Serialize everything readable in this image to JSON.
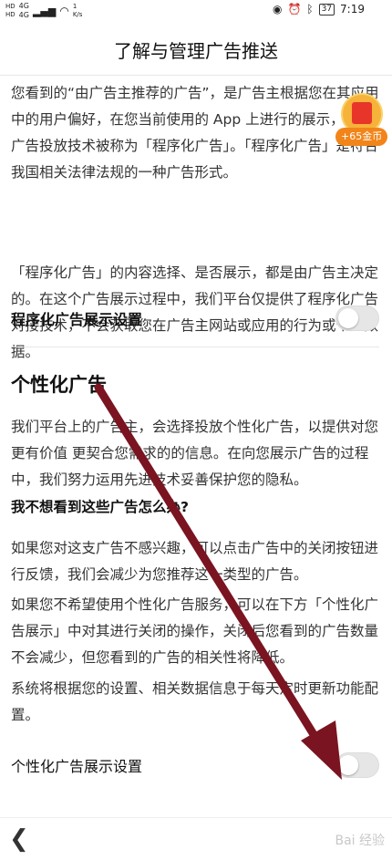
{
  "status_bar": {
    "sim1": "HD",
    "sim2": "HD",
    "net1": "4G",
    "net2": "4G",
    "speed": "1",
    "speed_unit": "K/s",
    "battery": "37",
    "time": "7:19"
  },
  "header": {
    "title": "了解与管理广告推送"
  },
  "intro": {
    "p1": "您看到的“由广告主推荐的广告”，是广告主根据您在其应用中的用户偏好，在您当前使用的 App 上进行的展示，这种广告投放技术被称为「程序化广告」。「程序化广告」是符合我国相关法律法规的一种广告形式。",
    "p2": "「程序化广告」的内容选择、是否展示，都是由广告主决定的。在这个广告展示过程中，我们平台仅提供了程序化广告对接技术，不会获取您在广告主网站或应用的行为或个人数据。"
  },
  "programmatic_setting": {
    "label": "程序化广告展示设置",
    "enabled": false
  },
  "personalized": {
    "title": "个性化广告",
    "p1": "我们平台上的广告主，会选择投放个性化广告，以提供对您更有价值 更契合您需求的的信息。在向您展示广告的过程中，我们努力运用先进技术妥善保护您的隐私。",
    "question": "我不想看到这些广告怎么办?",
    "p2": "如果您对这支广告不感兴趣，可以点击广告中的关闭按钮进行反馈，我们会减少为您推荐这一类型的广告。",
    "p3": "如果您不希望使用个性化广告服务，可以在下方「个性化广告展示」中对其进行关闭的操作，关闭后您看到的广告数量不会减少，但您看到的广告的相关性将降低。",
    "p4": "系统将根据您的设置、相关数据信息于每天定时更新功能配置。"
  },
  "personalized_setting": {
    "label": "个性化广告展示设置",
    "enabled": false
  },
  "coin_widget": {
    "badge": "+65金币"
  },
  "bottom": {
    "back_icon": "chevron-left-icon",
    "watermark": "Bai 经验"
  },
  "colors": {
    "arrow": "#7a1420",
    "coin_badge": "#f2851a",
    "toggle_off": "#e6e6e6"
  }
}
